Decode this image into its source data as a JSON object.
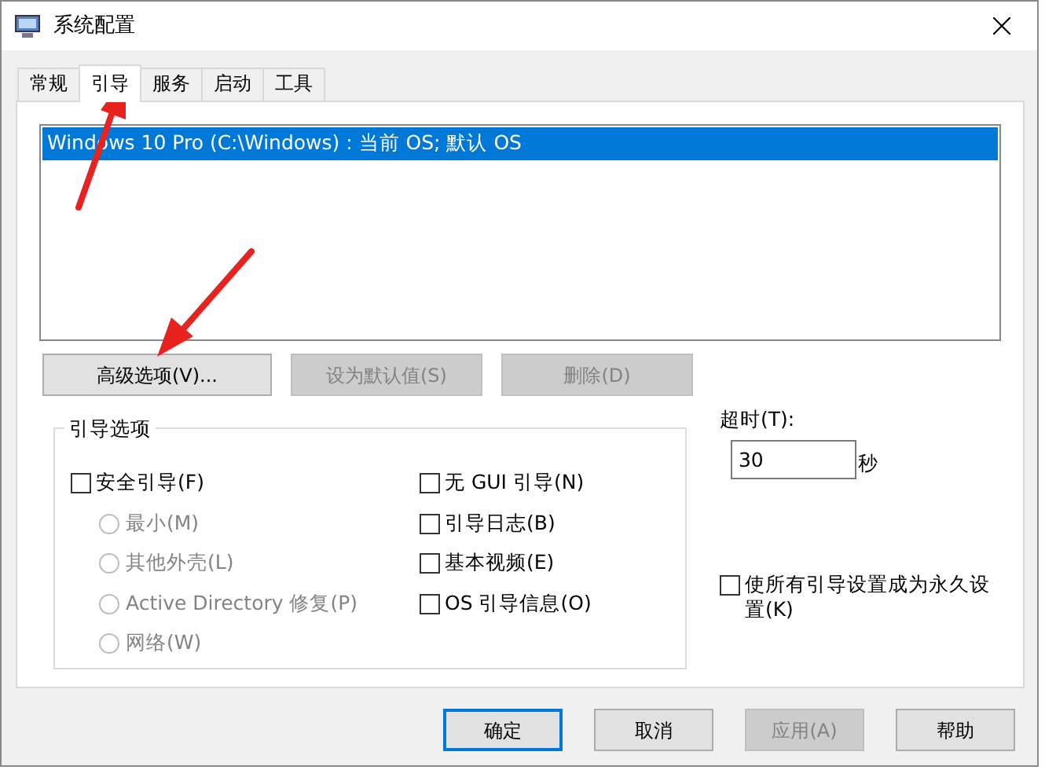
{
  "window": {
    "title": "系统配置"
  },
  "tabs": [
    {
      "label": "常规",
      "selected": false
    },
    {
      "label": "引导",
      "selected": true
    },
    {
      "label": "服务",
      "selected": false
    },
    {
      "label": "启动",
      "selected": false
    },
    {
      "label": "工具",
      "selected": false
    }
  ],
  "boot_list": [
    {
      "label": "Windows 10 Pro (C:\\Windows) : 当前 OS; 默认 OS",
      "selected": true
    }
  ],
  "list_buttons": [
    {
      "label": "高级选项(V)...",
      "disabled": false
    },
    {
      "label": "设为默认值(S)",
      "disabled": true
    },
    {
      "label": "删除(D)",
      "disabled": true
    }
  ],
  "boot_options": {
    "title": "引导选项",
    "left": [
      {
        "kind": "checkbox",
        "label": "安全引导(F)",
        "checked": false,
        "disabled": false
      },
      {
        "kind": "radio",
        "label": "最小(M)",
        "selected": false,
        "disabled": true
      },
      {
        "kind": "radio",
        "label": "其他外壳(L)",
        "selected": false,
        "disabled": true
      },
      {
        "kind": "radio",
        "label": "Active Directory 修复(P)",
        "selected": false,
        "disabled": true
      },
      {
        "kind": "radio",
        "label": "网络(W)",
        "selected": false,
        "disabled": true
      }
    ],
    "right": [
      {
        "kind": "checkbox",
        "label": "无 GUI 引导(N)",
        "checked": false,
        "disabled": false
      },
      {
        "kind": "checkbox",
        "label": "引导日志(B)",
        "checked": false,
        "disabled": false
      },
      {
        "kind": "checkbox",
        "label": "基本视频(E)",
        "checked": false,
        "disabled": false
      },
      {
        "kind": "checkbox",
        "label": "OS 引导信息(O)",
        "checked": false,
        "disabled": false
      }
    ]
  },
  "timeout": {
    "label": "超时(T):",
    "value": "30",
    "unit": "秒"
  },
  "permanent": {
    "label": "使所有引导设置成为永久设置(K)",
    "checked": false
  },
  "dialog_buttons": [
    {
      "label": "确定",
      "default": true,
      "disabled": false
    },
    {
      "label": "取消",
      "default": false,
      "disabled": false
    },
    {
      "label": "应用(A)",
      "default": false,
      "disabled": true
    },
    {
      "label": "帮助",
      "default": false,
      "disabled": false
    }
  ]
}
